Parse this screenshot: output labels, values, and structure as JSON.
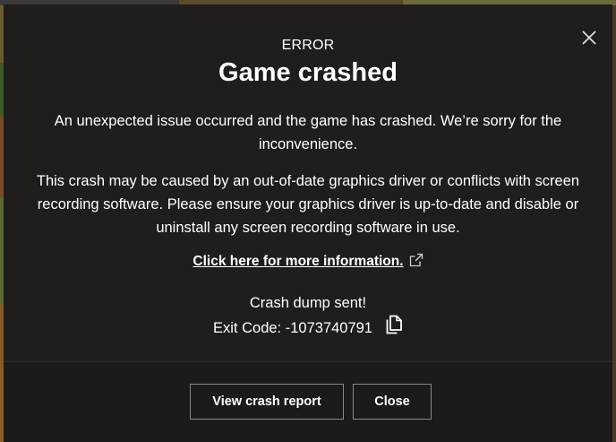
{
  "dialog": {
    "eyebrow": "ERROR",
    "title": "Game crashed",
    "message_1": "An unexpected issue occurred and the game has crashed. We’re sorry for the inconvenience.",
    "message_2": "This crash may be caused by an out-of-date graphics driver or conflicts with screen recording software. Please ensure your graphics driver is up-to-date and disable or uninstall any screen recording software in use.",
    "more_info_link": "Click here for more information.",
    "dump_status": "Crash dump sent!",
    "exit_code": "Exit Code: -1073740791",
    "icons": {
      "close": "close-icon",
      "external_link": "external-link-icon",
      "copy": "copy-icon"
    }
  },
  "footer": {
    "view_report_label": "View crash report",
    "close_label": "Close"
  },
  "colors": {
    "dialog_background": "#1f1e1d",
    "text": "#ffffff",
    "button_border": "#8a8a8a",
    "backdrop": "#4a3b22"
  }
}
